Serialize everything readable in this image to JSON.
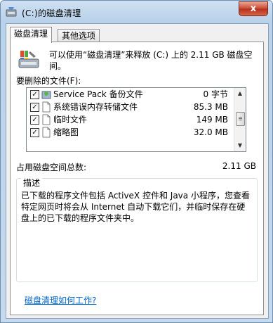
{
  "window": {
    "title": "(C:)的磁盘清理",
    "close_label": "x"
  },
  "tabs": [
    {
      "label": "磁盘清理",
      "active": true
    },
    {
      "label": "其他选项",
      "active": false
    }
  ],
  "intro": "可以使用“磁盘清理”来释放 (C:) 上的 2.11 GB 磁盘空间。",
  "files_to_delete_label": "要删除的文件(F):",
  "files": [
    {
      "name": "Service Pack 备份文件",
      "size": "0 字节",
      "checked": true,
      "icon": "service-pack-icon"
    },
    {
      "name": "系统错误内存转储文件",
      "size": "85.3 MB",
      "checked": true,
      "icon": "file-icon"
    },
    {
      "name": "临时文件",
      "size": "149 MB",
      "checked": true,
      "icon": "file-icon"
    },
    {
      "name": "缩略图",
      "size": "32.0 MB",
      "checked": true,
      "icon": "file-icon"
    }
  ],
  "total": {
    "label": "占用磁盘空间总数:",
    "value": "2.11 GB"
  },
  "description": {
    "legend": "描述",
    "text": "已下载的程序文件包括 ActiveX 控件和 Java 小程序，您查看特定网页时将会从 Internet 自动下载它们，并临时保存在硬盘上的已下载的程序文件夹中。"
  },
  "help_link": "磁盘清理如何工作?",
  "check_mark": "✓",
  "colors": {
    "link": "#0066cc",
    "close_button": "#c9462c",
    "title_bar": "#b9d1ea"
  }
}
